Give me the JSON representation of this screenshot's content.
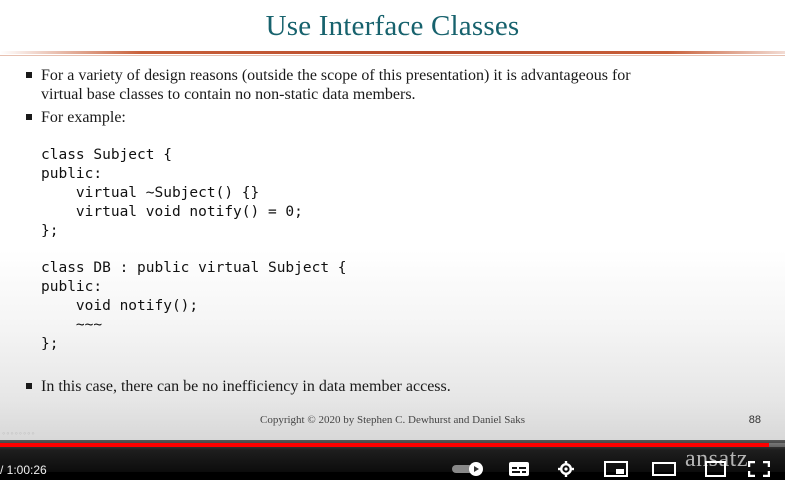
{
  "slide": {
    "title": "Use Interface Classes",
    "bullets": [
      "For a variety of design reasons (outside the scope of this presentation) it is advantageous for\nvirtual base classes to contain no non-static data members.",
      "For example:"
    ],
    "code_block_1": "class Subject {\npublic:\n    virtual ~Subject() {}\n    virtual void notify() = 0;\n};",
    "code_block_2": "class DB : public virtual Subject {\npublic:\n    void notify();\n    ~~~\n};",
    "final_bullet": "In this case, there can be no inefficiency in data member access.",
    "footer": "Copyright © 2020 by Stephen C. Dewhurst and Daniel Saks",
    "page_number": "88",
    "watermark": "◦◦◦◦◦◦◦◦"
  },
  "player": {
    "time_display": "/ 1:00:26",
    "progress_fraction": 0.98,
    "brand": "ansatz",
    "icons": [
      "autoplay-toggle-icon",
      "subtitles-icon",
      "settings-gear-icon",
      "miniplayer-icon",
      "theater-mode-icon",
      "cast-icon",
      "fullscreen-icon"
    ]
  }
}
